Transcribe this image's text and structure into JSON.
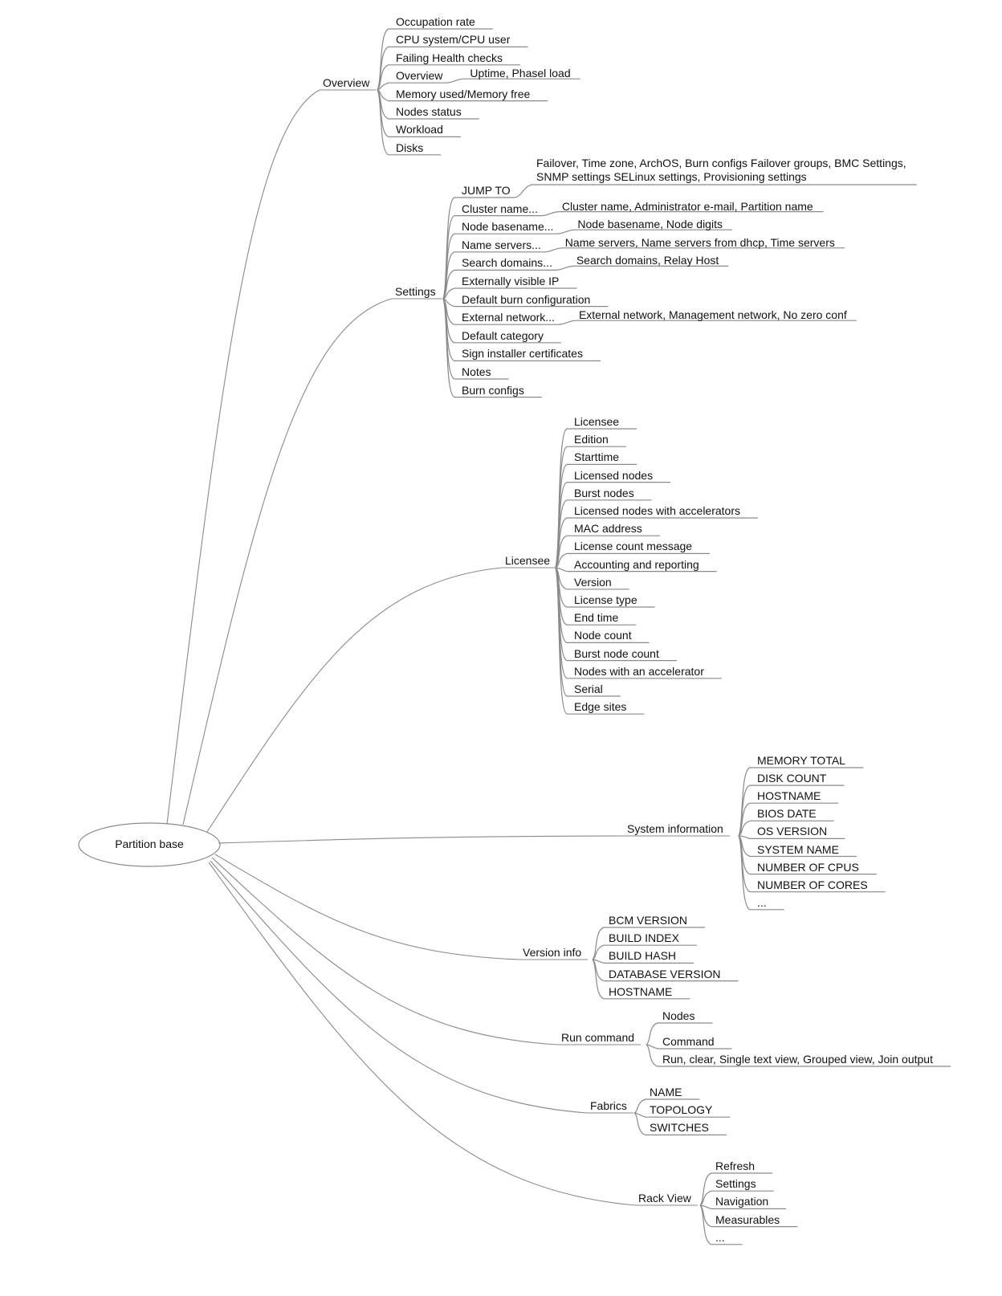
{
  "root": {
    "label": "Partition base"
  },
  "branches": [
    {
      "label": "Overview",
      "children": [
        {
          "label": "Occupation rate"
        },
        {
          "label": "CPU system/CPU user"
        },
        {
          "label": "Failing Health checks"
        },
        {
          "label": "Overview",
          "detail": "Uptime, Phasel load"
        },
        {
          "label": "Memory used/Memory free"
        },
        {
          "label": "Nodes status"
        },
        {
          "label": "Workload"
        },
        {
          "label": "Disks"
        }
      ]
    },
    {
      "label": "Settings",
      "children": [
        {
          "label": "JUMP TO",
          "detail": "Failover, Time zone, ArchOS, Burn configs Failover groups, BMC Settings,",
          "detail2": "SNMP settings SELinux settings, Provisioning settings"
        },
        {
          "label": "Cluster name...",
          "detail": "Cluster name, Administrator e-mail, Partition name"
        },
        {
          "label": "Node basename...",
          "detail": "Node basename, Node digits"
        },
        {
          "label": "Name servers...",
          "detail": "Name servers, Name servers from dhcp, Time servers"
        },
        {
          "label": "Search domains...",
          "detail": "Search domains, Relay Host"
        },
        {
          "label": "Externally visible IP"
        },
        {
          "label": "Default burn configuration"
        },
        {
          "label": "External network...",
          "detail": "External network, Management network, No zero conf"
        },
        {
          "label": "Default category"
        },
        {
          "label": "Sign installer certificates"
        },
        {
          "label": "Notes"
        },
        {
          "label": "Burn configs"
        }
      ]
    },
    {
      "label": "Licensee",
      "children": [
        {
          "label": "Licensee"
        },
        {
          "label": "Edition"
        },
        {
          "label": "Starttime"
        },
        {
          "label": "Licensed nodes"
        },
        {
          "label": "Burst nodes"
        },
        {
          "label": "Licensed nodes with accelerators"
        },
        {
          "label": "MAC address"
        },
        {
          "label": "License count message"
        },
        {
          "label": "Accounting and reporting"
        },
        {
          "label": "Version"
        },
        {
          "label": "License type"
        },
        {
          "label": "End time"
        },
        {
          "label": "Node count"
        },
        {
          "label": "Burst node count"
        },
        {
          "label": "Nodes with an accelerator"
        },
        {
          "label": "Serial"
        },
        {
          "label": "Edge sites"
        }
      ]
    },
    {
      "label": "System information",
      "children": [
        {
          "label": "MEMORY TOTAL"
        },
        {
          "label": "DISK COUNT"
        },
        {
          "label": "HOSTNAME"
        },
        {
          "label": "BIOS DATE"
        },
        {
          "label": "OS VERSION"
        },
        {
          "label": "SYSTEM NAME"
        },
        {
          "label": "NUMBER OF CPUS"
        },
        {
          "label": "NUMBER OF CORES"
        },
        {
          "label": "..."
        }
      ]
    },
    {
      "label": "Version info",
      "children": [
        {
          "label": "BCM VERSION"
        },
        {
          "label": "BUILD INDEX"
        },
        {
          "label": "BUILD HASH"
        },
        {
          "label": "DATABASE VERSION"
        },
        {
          "label": "HOSTNAME"
        }
      ]
    },
    {
      "label": "Run command",
      "children": [
        {
          "label": "Nodes"
        },
        {
          "label": "Command"
        },
        {
          "label": "Run, clear, Single text view, Grouped view, Join output"
        }
      ]
    },
    {
      "label": "Fabrics",
      "children": [
        {
          "label": "NAME"
        },
        {
          "label": "TOPOLOGY"
        },
        {
          "label": "SWITCHES"
        }
      ]
    },
    {
      "label": "Rack View",
      "children": [
        {
          "label": "Refresh"
        },
        {
          "label": "Settings"
        },
        {
          "label": "Navigation"
        },
        {
          "label": "Measurables"
        },
        {
          "label": "..."
        }
      ]
    }
  ],
  "colors": {
    "line": "#8a8a8a",
    "text": "#111111"
  }
}
